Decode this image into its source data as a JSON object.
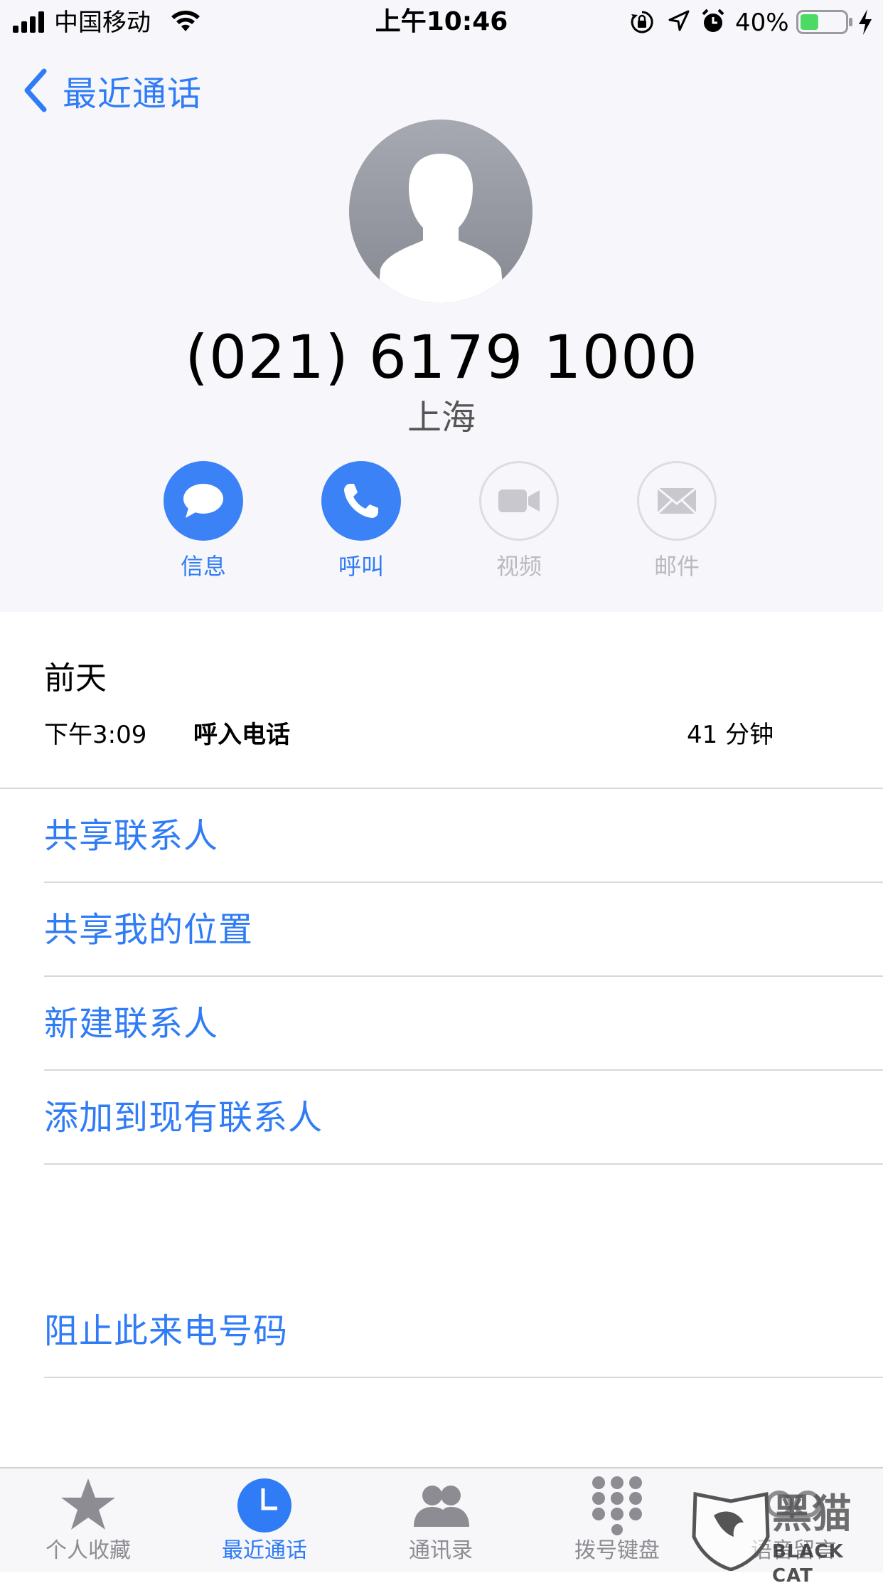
{
  "status_bar": {
    "carrier": "中国移动",
    "time": "上午10:46",
    "battery_percent": "40%",
    "battery_level": 0.4,
    "icons": [
      "signal-icon",
      "wifi-icon",
      "rotation-lock-icon",
      "location-icon",
      "alarm-icon",
      "battery-icon",
      "charging-icon"
    ]
  },
  "nav": {
    "back_label": "最近通话"
  },
  "contact": {
    "number": "(021) 6179 1000",
    "location": "上海"
  },
  "actions": [
    {
      "label": "信息",
      "icon": "message-icon",
      "enabled": true
    },
    {
      "label": "呼叫",
      "icon": "phone-icon",
      "enabled": true
    },
    {
      "label": "视频",
      "icon": "video-icon",
      "enabled": false
    },
    {
      "label": "邮件",
      "icon": "mail-icon",
      "enabled": false
    }
  ],
  "call_log": {
    "date": "前天",
    "time": "下午3:09",
    "type": "呼入电话",
    "duration": "41 分钟"
  },
  "menu": [
    "共享联系人",
    "共享我的位置",
    "新建联系人",
    "添加到现有联系人"
  ],
  "block": "阻止此来电号码",
  "tabs": [
    {
      "label": "个人收藏",
      "icon": "star-icon",
      "active": false
    },
    {
      "label": "最近通话",
      "icon": "clock-icon",
      "active": true
    },
    {
      "label": "通讯录",
      "icon": "contacts-icon",
      "active": false
    },
    {
      "label": "拨号键盘",
      "icon": "keypad-icon",
      "active": false
    },
    {
      "label": "语音留言",
      "icon": "voicemail-icon",
      "active": false
    }
  ],
  "watermark": {
    "text": "黑猫",
    "sub": "BLACK CAT"
  },
  "colors": {
    "accent": "#2f7cf6",
    "disabled": "#b9b9c0",
    "header_bg": "#f7f7fb"
  }
}
